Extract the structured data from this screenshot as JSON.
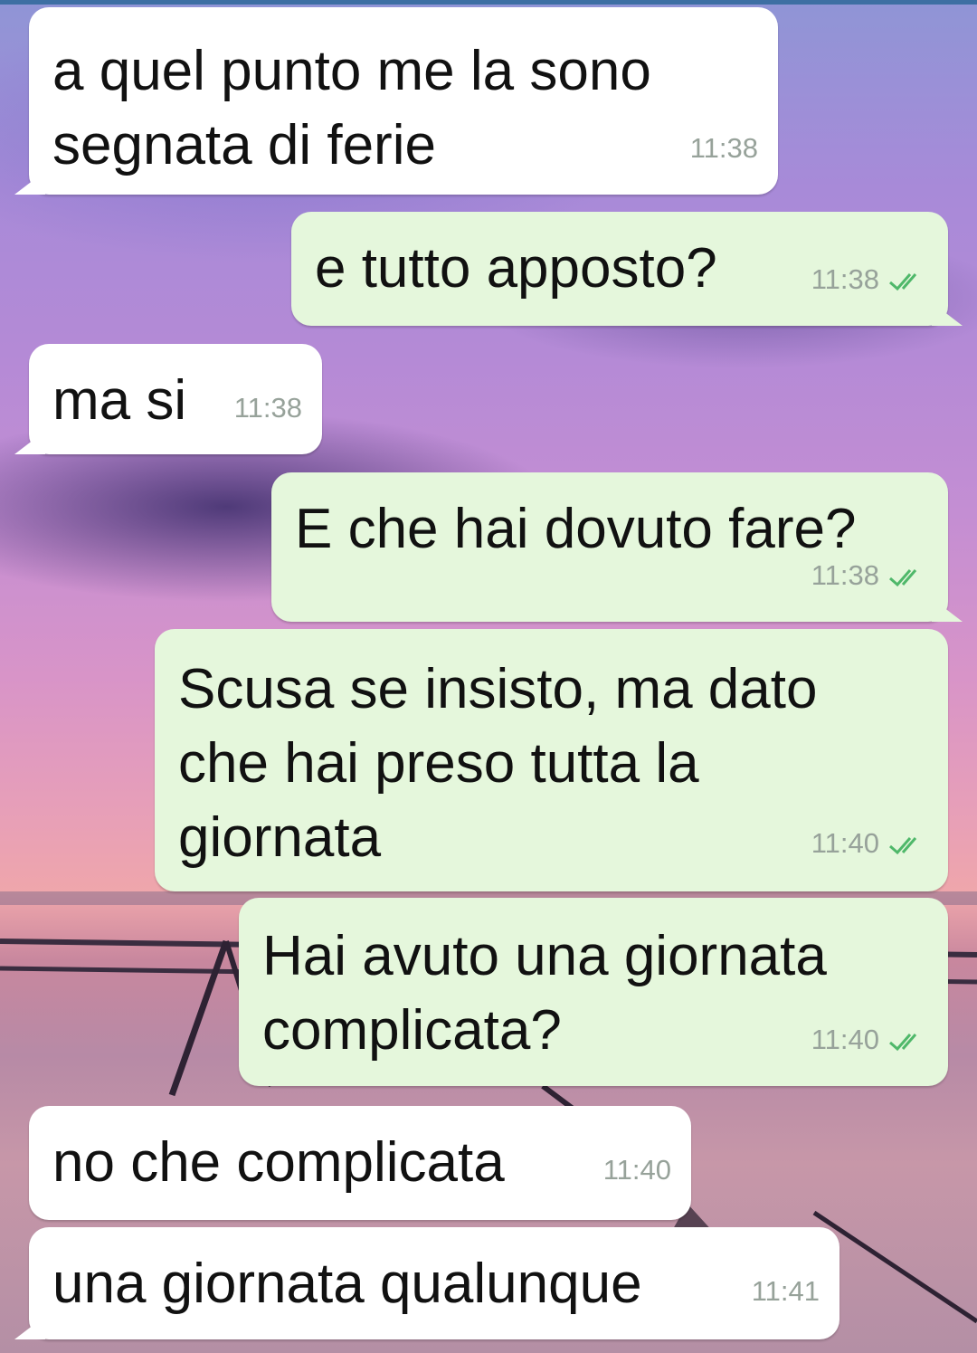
{
  "messages": [
    {
      "direction": "incoming",
      "text": "a quel punto me la sono\nsegnata di ferie",
      "time": "11:38"
    },
    {
      "direction": "outgoing",
      "text": "e tutto apposto?",
      "time": "11:38",
      "status": "read"
    },
    {
      "direction": "incoming",
      "text": "ma si",
      "time": "11:38"
    },
    {
      "direction": "outgoing",
      "text": "E che hai dovuto fare?",
      "time": "11:38",
      "status": "read"
    },
    {
      "direction": "outgoing",
      "text": "Scusa se insisto, ma dato\nche hai preso tutta la\ngiornata",
      "time": "11:40",
      "status": "read"
    },
    {
      "direction": "outgoing",
      "text": "Hai avuto una giornata\ncomplicata?",
      "time": "11:40",
      "status": "read"
    },
    {
      "direction": "incoming",
      "text": "no che complicata",
      "time": "11:40"
    },
    {
      "direction": "incoming",
      "text": "una giornata qualunque",
      "time": "11:41"
    }
  ],
  "colors": {
    "incoming_bubble": "#ffffff",
    "outgoing_bubble": "#e5f7dc",
    "read_ticks": "#4fb86a",
    "timestamp": "#97a29a"
  },
  "icons": {
    "read_receipt": "double-check-icon"
  }
}
